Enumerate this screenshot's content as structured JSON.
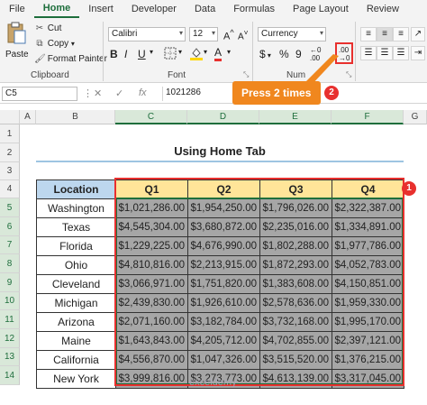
{
  "ribbon": {
    "tabs": [
      "File",
      "Home",
      "Insert",
      "Developer",
      "Data",
      "Formulas",
      "Page Layout",
      "Review"
    ],
    "active_tab": "Home",
    "clipboard": {
      "paste": "Paste",
      "cut": "Cut",
      "copy": "Copy",
      "format_painter": "Format Painter",
      "label": "Clipboard"
    },
    "font": {
      "name": "Calibri",
      "size": "12",
      "bold": "B",
      "italic": "I",
      "underline": "U",
      "label": "Font"
    },
    "number": {
      "format": "Currency",
      "label": "Num",
      "dollar": "$",
      "percent": "%",
      "comma": "9"
    }
  },
  "formula_bar": {
    "name_box": "C5",
    "fx": "fx",
    "value": "1021286"
  },
  "callout": {
    "text": "Press 2 times",
    "badge": "2"
  },
  "badge1": "1",
  "columns": [
    "A",
    "B",
    "C",
    "D",
    "E",
    "F",
    "G"
  ],
  "rows": [
    "1",
    "2",
    "3",
    "4",
    "5",
    "6",
    "7",
    "8",
    "9",
    "10",
    "11",
    "12",
    "13",
    "14"
  ],
  "sheet": {
    "title": "Using Home Tab",
    "headers": [
      "Location",
      "Q1",
      "Q2",
      "Q3",
      "Q4"
    ],
    "rows": [
      [
        "Washington",
        "$1,021,286.00",
        "$1,954,250.00",
        "$1,796,026.00",
        "$2,322,387.00"
      ],
      [
        "Texas",
        "$4,545,304.00",
        "$3,680,872.00",
        "$2,235,016.00",
        "$1,334,891.00"
      ],
      [
        "Florida",
        "$1,229,225.00",
        "$4,676,990.00",
        "$1,802,288.00",
        "$1,977,786.00"
      ],
      [
        "Ohio",
        "$4,810,816.00",
        "$2,213,915.00",
        "$1,872,293.00",
        "$4,052,783.00"
      ],
      [
        "Cleveland",
        "$3,066,971.00",
        "$1,751,820.00",
        "$1,383,608.00",
        "$4,150,851.00"
      ],
      [
        "Michigan",
        "$2,439,830.00",
        "$1,926,610.00",
        "$2,578,636.00",
        "$1,959,330.00"
      ],
      [
        "Arizona",
        "$2,071,160.00",
        "$3,182,784.00",
        "$3,732,168.00",
        "$1,995,170.00"
      ],
      [
        "Maine",
        "$1,643,843.00",
        "$4,205,712.00",
        "$4,702,855.00",
        "$2,397,121.00"
      ],
      [
        "California",
        "$4,556,870.00",
        "$1,047,326.00",
        "$3,515,520.00",
        "$1,376,215.00"
      ],
      [
        "New York",
        "$3,999,816.00",
        "$3,273,773.00",
        "$4,613,139.00",
        "$3,317,045.00"
      ]
    ]
  },
  "watermark": "exceldemy"
}
